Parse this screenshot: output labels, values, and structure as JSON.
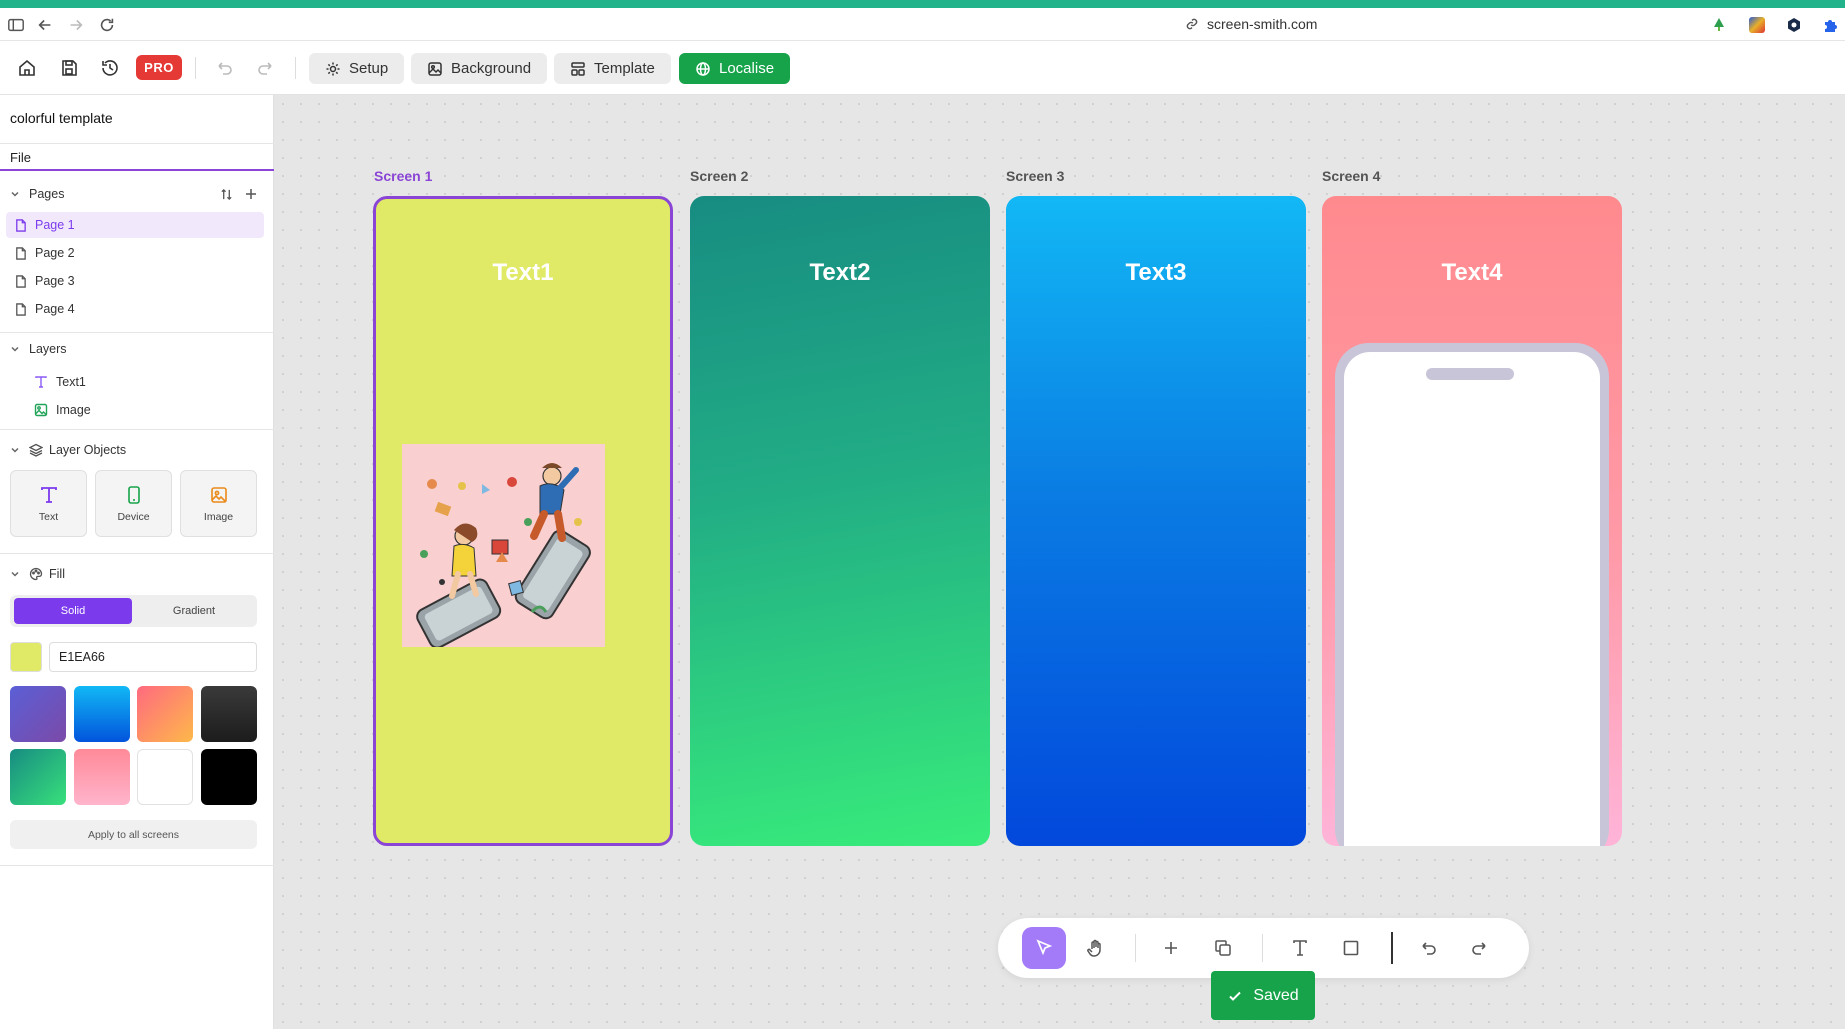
{
  "browser": {
    "url": "screen-smith.com"
  },
  "toolbar": {
    "pro_label": "PRO",
    "setup_label": "Setup",
    "background_label": "Background",
    "template_label": "Template",
    "localise_label": "Localise"
  },
  "sidebar": {
    "project_name": "colorful template",
    "file_menu": "File",
    "pages_heading": "Pages",
    "pages": [
      {
        "label": "Page 1",
        "active": true
      },
      {
        "label": "Page 2",
        "active": false
      },
      {
        "label": "Page 3",
        "active": false
      },
      {
        "label": "Page 4",
        "active": false
      }
    ],
    "layers_heading": "Layers",
    "layers": [
      {
        "label": "Text1",
        "icon": "text-icon"
      },
      {
        "label": "Image",
        "icon": "image-icon"
      }
    ],
    "layer_objects_heading": "Layer Objects",
    "layer_objects": [
      {
        "label": "Text",
        "icon": "text-icon"
      },
      {
        "label": "Device",
        "icon": "device-icon"
      },
      {
        "label": "Image",
        "icon": "image-icon"
      }
    ],
    "fill_heading": "Fill",
    "fill_tabs": {
      "solid": "Solid",
      "gradient": "Gradient"
    },
    "fill_hex": "E1EA66",
    "apply_all_label": "Apply to all screens"
  },
  "canvas": {
    "screens": [
      {
        "label": "Screen 1",
        "text": "Text1"
      },
      {
        "label": "Screen 2",
        "text": "Text2"
      },
      {
        "label": "Screen 3",
        "text": "Text3"
      },
      {
        "label": "Screen 4",
        "text": "Text4"
      }
    ]
  },
  "status": {
    "saved_label": "Saved"
  },
  "colors": {
    "accent": "#7c3aed",
    "localise_green": "#16a34a",
    "screen1_fill": "#E1EA66",
    "pro_red": "#e53935"
  }
}
